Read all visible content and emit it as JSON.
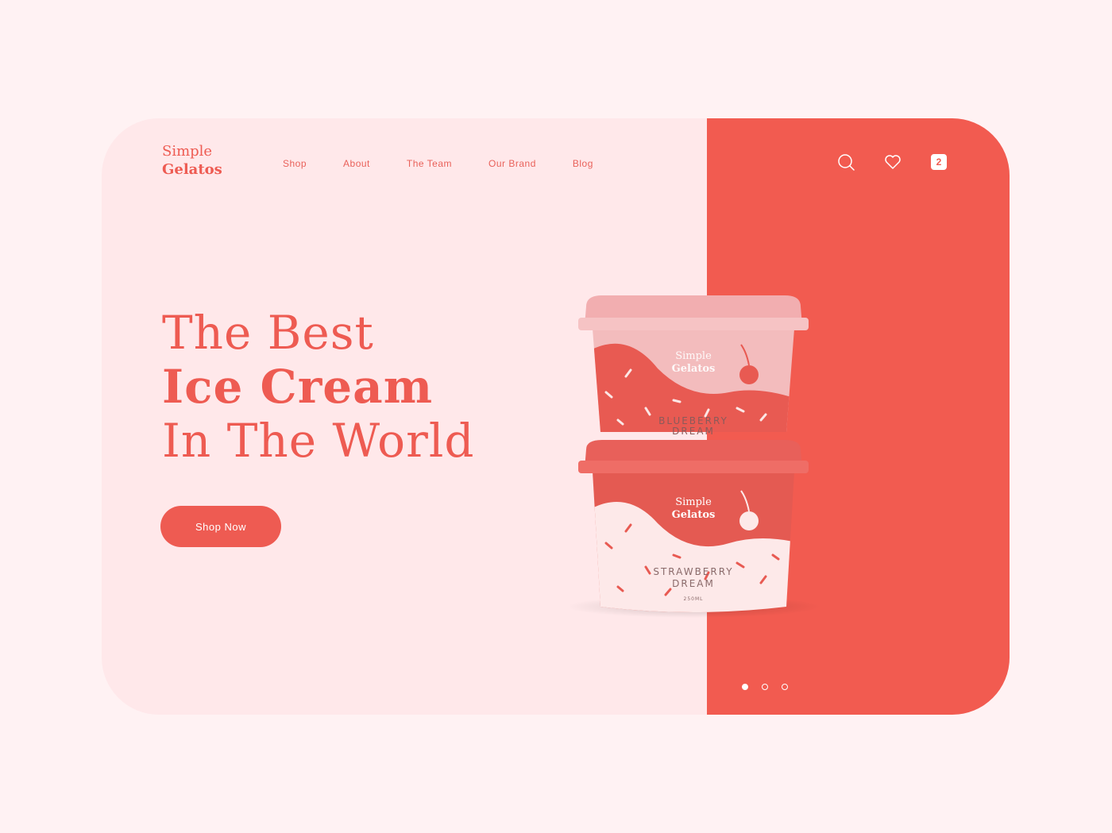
{
  "brand": {
    "line1": "Simple",
    "line2": "Gelatos"
  },
  "nav": [
    "Shop",
    "About",
    "The Team",
    "Our Brand",
    "Blog"
  ],
  "header": {
    "cart_count": "2"
  },
  "hero": {
    "line1": "The Best",
    "line2": "Ice Cream",
    "line3": "In The World",
    "cta": "Shop Now"
  },
  "products": {
    "top": {
      "brand1": "Simple",
      "brand2": "Gelatos",
      "flavor1": "BLUEBERRY",
      "flavor2": "DREAM"
    },
    "bottom": {
      "brand1": "Simple",
      "brand2": "Gelatos",
      "flavor1": "STRAWBERRY",
      "flavor2": "DREAM",
      "volume": "250ML"
    }
  },
  "carousel": {
    "active_index": 0,
    "count": 3
  },
  "colors": {
    "accent": "#f25b50",
    "background": "#fff2f3",
    "card": "#ffe8ea"
  }
}
